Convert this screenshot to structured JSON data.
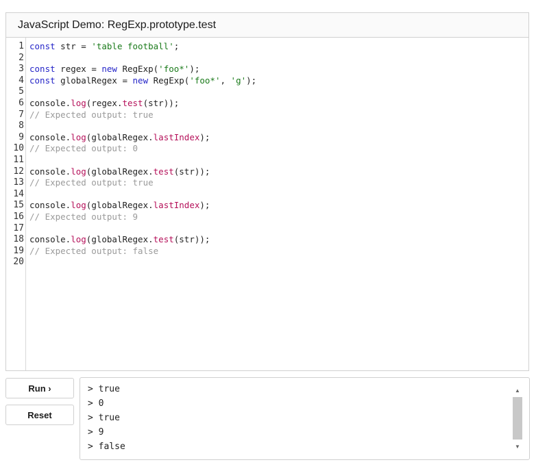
{
  "header": {
    "title": "JavaScript Demo: RegExp.prototype.test"
  },
  "editor": {
    "line_numbers": [
      "1",
      "2",
      "3",
      "4",
      "5",
      "6",
      "7",
      "8",
      "9",
      "10",
      "11",
      "12",
      "13",
      "14",
      "15",
      "16",
      "17",
      "18",
      "19",
      "20"
    ],
    "lines": [
      [
        {
          "t": "kw",
          "v": "const"
        },
        {
          "t": "plain",
          "v": " str = "
        },
        {
          "t": "str",
          "v": "'table football'"
        },
        {
          "t": "plain",
          "v": ";"
        }
      ],
      [],
      [
        {
          "t": "kw",
          "v": "const"
        },
        {
          "t": "plain",
          "v": " regex = "
        },
        {
          "t": "kw",
          "v": "new"
        },
        {
          "t": "plain",
          "v": " RegExp("
        },
        {
          "t": "str",
          "v": "'foo*'"
        },
        {
          "t": "plain",
          "v": ");"
        }
      ],
      [
        {
          "t": "kw",
          "v": "const"
        },
        {
          "t": "plain",
          "v": " globalRegex = "
        },
        {
          "t": "kw",
          "v": "new"
        },
        {
          "t": "plain",
          "v": " RegExp("
        },
        {
          "t": "str",
          "v": "'foo*'"
        },
        {
          "t": "plain",
          "v": ", "
        },
        {
          "t": "str",
          "v": "'g'"
        },
        {
          "t": "plain",
          "v": ");"
        }
      ],
      [],
      [
        {
          "t": "plain",
          "v": "console."
        },
        {
          "t": "fn",
          "v": "log"
        },
        {
          "t": "plain",
          "v": "(regex."
        },
        {
          "t": "fn",
          "v": "test"
        },
        {
          "t": "plain",
          "v": "(str));"
        }
      ],
      [
        {
          "t": "cm",
          "v": "// Expected output: true"
        }
      ],
      [],
      [
        {
          "t": "plain",
          "v": "console."
        },
        {
          "t": "fn",
          "v": "log"
        },
        {
          "t": "plain",
          "v": "(globalRegex."
        },
        {
          "t": "fn",
          "v": "lastIndex"
        },
        {
          "t": "plain",
          "v": ");"
        }
      ],
      [
        {
          "t": "cm",
          "v": "// Expected output: 0"
        }
      ],
      [],
      [
        {
          "t": "plain",
          "v": "console."
        },
        {
          "t": "fn",
          "v": "log"
        },
        {
          "t": "plain",
          "v": "(globalRegex."
        },
        {
          "t": "fn",
          "v": "test"
        },
        {
          "t": "plain",
          "v": "(str));"
        }
      ],
      [
        {
          "t": "cm",
          "v": "// Expected output: true"
        }
      ],
      [],
      [
        {
          "t": "plain",
          "v": "console."
        },
        {
          "t": "fn",
          "v": "log"
        },
        {
          "t": "plain",
          "v": "(globalRegex."
        },
        {
          "t": "fn",
          "v": "lastIndex"
        },
        {
          "t": "plain",
          "v": ");"
        }
      ],
      [
        {
          "t": "cm",
          "v": "// Expected output: 9"
        }
      ],
      [],
      [
        {
          "t": "plain",
          "v": "console."
        },
        {
          "t": "fn",
          "v": "log"
        },
        {
          "t": "plain",
          "v": "(globalRegex."
        },
        {
          "t": "fn",
          "v": "test"
        },
        {
          "t": "plain",
          "v": "(str));"
        }
      ],
      [
        {
          "t": "cm",
          "v": "// Expected output: false"
        }
      ],
      []
    ]
  },
  "buttons": {
    "run_label": "Run ›",
    "reset_label": "Reset"
  },
  "console": {
    "lines": [
      "> true",
      "> 0",
      "> true",
      "> 9",
      "> false"
    ],
    "scroll_up_icon": "▲",
    "scroll_down_icon": "▼"
  },
  "colors": {
    "keyword": "#2525c8",
    "string": "#1a7a1a",
    "function": "#b5115a",
    "comment": "#9a9a9a"
  }
}
